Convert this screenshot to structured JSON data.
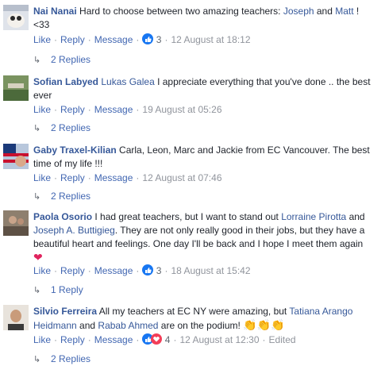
{
  "actions": {
    "like": "Like",
    "reply": "Reply",
    "message": "Message",
    "dot": "·"
  },
  "comments": [
    {
      "author": "Nai Nanai",
      "text": [
        " Hard to choose between two amazing teachers: ",
        "Joseph",
        " and ",
        "Matt",
        " ! <33"
      ],
      "reaction_count": "3",
      "time": "12 August at 18:12",
      "replies": "2 Replies"
    },
    {
      "author": "Sofian Labyed",
      "mention": "Lukas Galea",
      "text": " I appreciate everything that you've done .. the best ever",
      "time": "19 August at 05:26",
      "replies": "2 Replies"
    },
    {
      "author": "Gaby Traxel-Kilian",
      "text": " Carla, Leon, Marc and Jackie from EC Vancouver. The best time of my life !!!",
      "time": "12 August at 07:46",
      "replies": "2 Replies"
    },
    {
      "author": "Paola Osorio",
      "text_a": " I had great teachers, but I want to stand out ",
      "mention_a": "Lorraine Pirotta",
      "text_b": " and ",
      "mention_b": "Joseph A. Buttigieg",
      "text_c": ". They are not only really good in their jobs, but they have a beautiful heart and feelings. One day I'll be back and I hope I meet them again",
      "emoji": "❤",
      "reaction_count": "3",
      "time": "18 August at 15:42",
      "replies": "1 Reply"
    },
    {
      "author": "Silvio Ferreira",
      "text_a": " All my teachers at EC NY were amazing, but ",
      "mention_a": "Tatiana Arango Heidmann",
      "text_b": " and ",
      "mention_b": "Rabab Ahmed",
      "text_c": " are on the podium! ",
      "emoji": "👏👏👏",
      "reaction_count": "4",
      "time": "12 August at 12:30",
      "edited": "Edited",
      "replies": "2 Replies"
    }
  ],
  "colors": {
    "link": "#365899",
    "action": "#4267b2",
    "meta": "#90949c",
    "like_blue": "#1877f2",
    "love_red": "#f33e58"
  }
}
